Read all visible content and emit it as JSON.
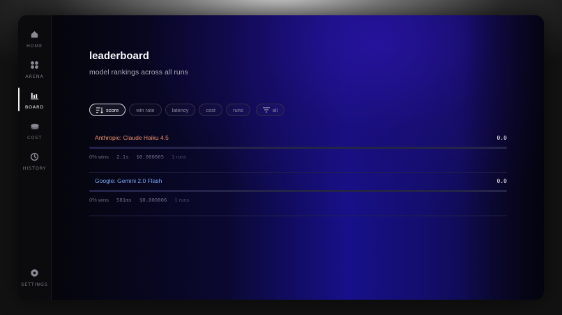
{
  "sidebar": {
    "items": [
      {
        "label": "HOME",
        "icon": "home-icon"
      },
      {
        "label": "ARENA",
        "icon": "grid-icon"
      },
      {
        "label": "BOARD",
        "icon": "bar-chart-icon",
        "active": true
      },
      {
        "label": "COST",
        "icon": "coins-icon"
      },
      {
        "label": "HISTORY",
        "icon": "clock-icon"
      }
    ],
    "settings_label": "SETTINGS"
  },
  "header": {
    "title": "leaderboard",
    "subtitle": "model rankings across all runs"
  },
  "filters": {
    "sort_options": [
      "score",
      "win rate",
      "latency",
      "cost",
      "runs"
    ],
    "active": "score",
    "filter_label": "all"
  },
  "leaderboard": [
    {
      "name": "Anthropic: Claude Haiku 4.5",
      "score": "0.0",
      "score_fraction": 0,
      "color": "#f0906a",
      "wins": "0% wins",
      "latency": "2.1s",
      "cost": "$0.000865",
      "runs": "1 runs"
    },
    {
      "name": "Google: Gemini 2.0 Flash",
      "score": "0.0",
      "score_fraction": 0,
      "color": "#7aa6f5",
      "wins": "0% wins",
      "latency": "581ms",
      "cost": "$0.000006",
      "runs": "1 runs"
    }
  ]
}
